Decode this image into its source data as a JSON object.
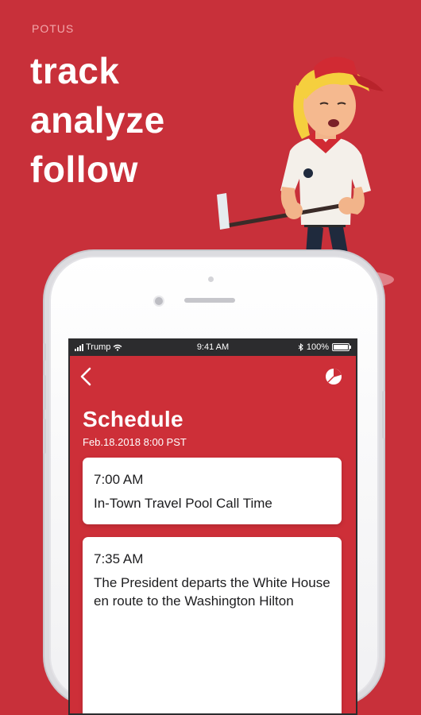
{
  "promo": {
    "eyebrow": "POTUS",
    "tagline": [
      "track",
      "analyze",
      "follow"
    ]
  },
  "status_bar": {
    "carrier": "Trump",
    "time": "9:41 AM",
    "battery": "100%"
  },
  "nav": {
    "back_icon": "chevron-left-icon",
    "chart_icon": "pie-chart-icon"
  },
  "screen": {
    "title": "Schedule",
    "subtitle": "Feb.18.2018 8:00 PST"
  },
  "events": [
    {
      "time": "7:00 AM",
      "description": "In-Town Travel Pool Call Time"
    },
    {
      "time": "7:35 AM",
      "description": "The President departs the White House en route to the Washington Hilton"
    }
  ],
  "colors": {
    "background": "#c8303a",
    "screen": "#cd2f38",
    "card": "#ffffff"
  }
}
